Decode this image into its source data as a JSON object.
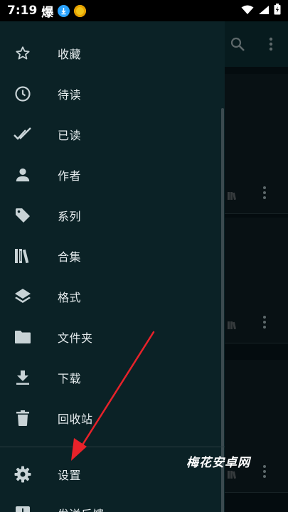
{
  "status_bar": {
    "time": "7:19",
    "app_glyph": "爆",
    "icons": [
      "download-notification-icon",
      "app-notification-icon",
      "wifi-icon",
      "signal-icon",
      "battery-icon"
    ]
  },
  "toolbar": {
    "icons": [
      "search-icon",
      "overflow-menu-icon"
    ]
  },
  "drawer": {
    "items": [
      {
        "label": "收藏",
        "icon": "star-icon"
      },
      {
        "label": "待读",
        "icon": "clock-icon"
      },
      {
        "label": "已读",
        "icon": "double-check-icon"
      },
      {
        "label": "作者",
        "icon": "person-icon"
      },
      {
        "label": "系列",
        "icon": "tag-icon"
      },
      {
        "label": "合集",
        "icon": "library-icon"
      },
      {
        "label": "格式",
        "icon": "layers-icon"
      },
      {
        "label": "文件夹",
        "icon": "folder-icon"
      },
      {
        "label": "下载",
        "icon": "download-icon"
      },
      {
        "label": "回收站",
        "icon": "trash-icon"
      },
      {
        "label": "设置",
        "icon": "gear-icon"
      },
      {
        "label": "发送反馈",
        "icon": "feedback-icon"
      }
    ]
  },
  "watermark": "梅花安卓网",
  "colors": {
    "drawer_bg": "#0b2226",
    "toolbar_bg": "#0b2a2e",
    "icon": "#c8d3d6",
    "annotation_arrow": "#e8222a"
  }
}
